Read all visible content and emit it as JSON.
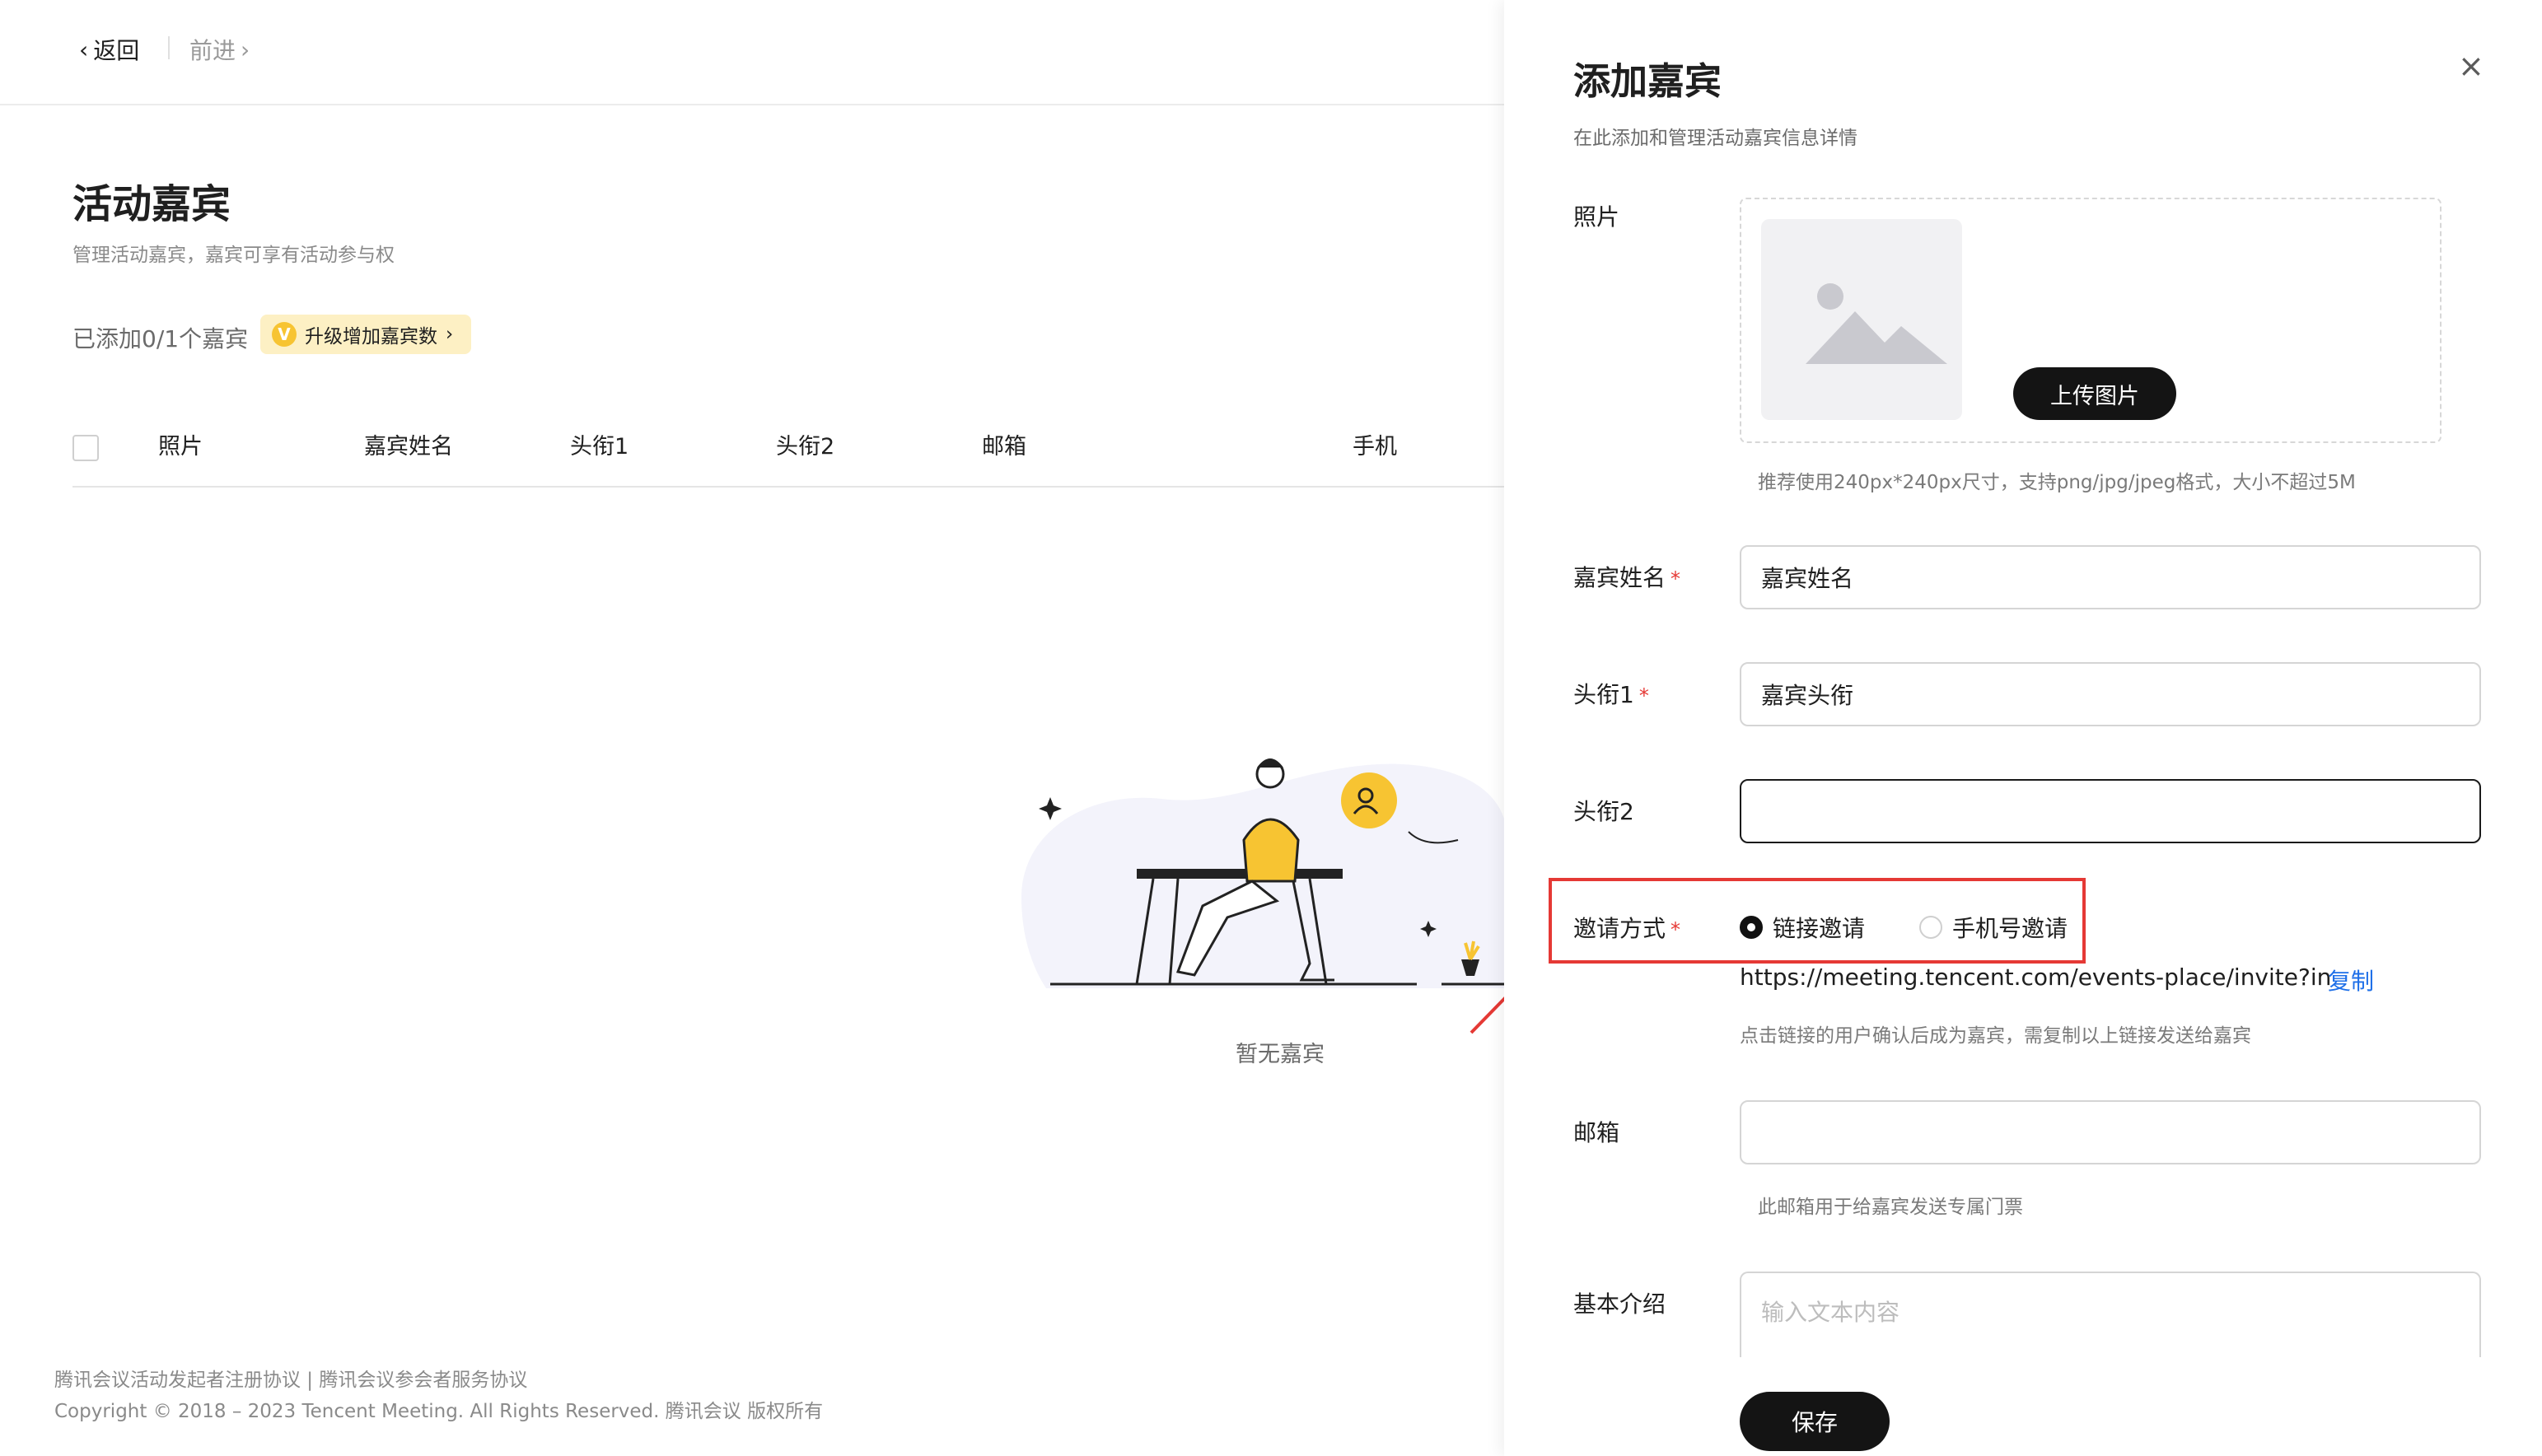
{
  "nav": {
    "back_label": "返回",
    "forward_label": "前进"
  },
  "page": {
    "title": "活动嘉宾",
    "subtitle": "管理活动嘉宾，嘉宾可享有活动参与权",
    "count_text": "已添加0/1个嘉宾",
    "upgrade_label": "升级增加嘉宾数",
    "upgrade_badge_letter": "V"
  },
  "table": {
    "columns": [
      "照片",
      "嘉宾姓名",
      "头衔1",
      "头衔2",
      "邮箱",
      "手机"
    ],
    "empty_text": "暂无嘉宾"
  },
  "footer": {
    "agreements": "腾讯会议活动发起者注册协议 | 腾讯会议参会者服务协议",
    "copyright": "Copyright © 2018 – 2023 Tencent Meeting. All Rights Reserved. 腾讯会议 版权所有"
  },
  "drawer": {
    "title": "添加嘉宾",
    "subtitle": "在此添加和管理活动嘉宾信息详情",
    "close_icon": "×",
    "photo": {
      "label": "照片",
      "upload_button": "上传图片",
      "hint": "推荐使用240px*240px尺寸，支持png/jpg/jpeg格式，大小不超过5M"
    },
    "name": {
      "label": "嘉宾姓名",
      "required_mark": "*",
      "value": "嘉宾姓名"
    },
    "title1": {
      "label": "头衔1",
      "required_mark": "*",
      "value": "嘉宾头衔"
    },
    "title2": {
      "label": "头衔2",
      "value": ""
    },
    "invite": {
      "label": "邀请方式",
      "required_mark": "*",
      "options": [
        "链接邀请",
        "手机号邀请"
      ],
      "selected": "链接邀请",
      "link": "https://meeting.tencent.com/events-place/invite?in",
      "copy_label": "复制",
      "hint": "点击链接的用户确认后成为嘉宾，需复制以上链接发送给嘉宾"
    },
    "email": {
      "label": "邮箱",
      "value": "",
      "hint": "此邮箱用于给嘉宾发送专属门票"
    },
    "intro": {
      "label": "基本介绍",
      "placeholder": "输入文本内容"
    },
    "save_label": "保存"
  },
  "colors": {
    "accent": "#141414",
    "required": "#e53935",
    "link": "#1e6fe8",
    "highlight_box": "#e53935",
    "upgrade_bg": "#fdf0c4"
  }
}
